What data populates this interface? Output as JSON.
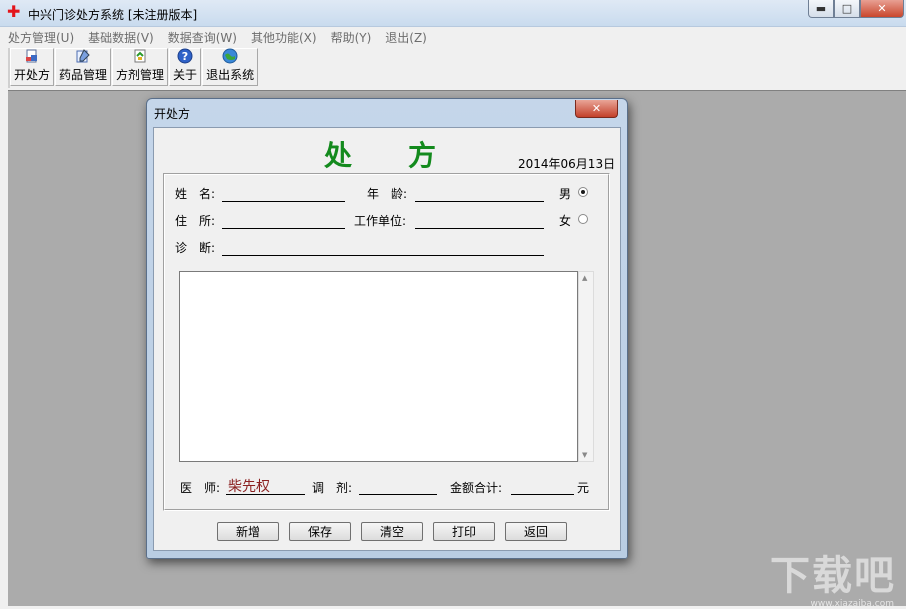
{
  "window": {
    "title": "中兴门诊处方系统   [未注册版本]",
    "app_icon": "✚",
    "controls": {
      "minimize": "▬",
      "maximize": "□",
      "close": "✕"
    }
  },
  "menu": [
    "处方管理(U)",
    "基础数据(V)",
    "数据查询(W)",
    "其他功能(X)",
    "帮助(Y)",
    "退出(Z)"
  ],
  "toolbar": [
    {
      "label": "开处方",
      "icon": "prescription-icon"
    },
    {
      "label": "药品管理",
      "icon": "drug-icon"
    },
    {
      "label": "方剂管理",
      "icon": "formula-icon"
    },
    {
      "label": "关于",
      "icon": "help-icon"
    },
    {
      "label": "退出系统",
      "icon": "exit-globe-icon"
    }
  ],
  "dialog": {
    "title": "开处方",
    "close": "✕",
    "heading": "处方",
    "date": "2014年06月13日",
    "fields": {
      "name_label": "姓　名:",
      "age_label": "年　龄:",
      "address_label": "住　所:",
      "workplace_label": "工作单位:",
      "diagnosis_label": "诊　断:",
      "male_label": "男",
      "female_label": "女",
      "gender_selected": "男"
    },
    "footer": {
      "doctor_label": "医　师:",
      "doctor_value": "柴先权",
      "dispense_label": "调　剂:",
      "total_label": "金额合计:",
      "currency": "元"
    },
    "buttons": [
      "新增",
      "保存",
      "清空",
      "打印",
      "返回"
    ]
  },
  "watermark": {
    "text": "下载吧",
    "url": "www.xiazaiba.com"
  },
  "colors": {
    "heading": "#138a1d",
    "doctor_name": "#8b1f1f",
    "workspace": "#ababab"
  }
}
